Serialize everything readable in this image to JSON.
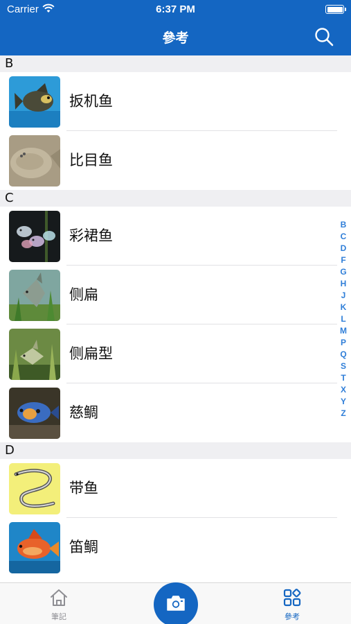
{
  "status_bar": {
    "carrier": "Carrier",
    "time": "6:37 PM"
  },
  "nav": {
    "title": "參考",
    "search_icon": "search-icon"
  },
  "colors": {
    "brand": "#1466c2",
    "index": "#2f7ed8",
    "section_bg": "#efeff2"
  },
  "sections": [
    {
      "letter": "B",
      "items": [
        {
          "name": "扳机鱼",
          "thumb": "triggerfish-photo"
        },
        {
          "name": "比目鱼",
          "thumb": "flounder-photo"
        }
      ]
    },
    {
      "letter": "C",
      "items": [
        {
          "name": "彩裙鱼",
          "thumb": "skirt-tetra-photo"
        },
        {
          "name": "侧扁",
          "thumb": "laterally-flat-fish-photo"
        },
        {
          "name": "侧扁型",
          "thumb": "laterally-flat-type-photo"
        },
        {
          "name": "慈鲷",
          "thumb": "cichlid-photo"
        }
      ]
    },
    {
      "letter": "D",
      "items": [
        {
          "name": "带鱼",
          "thumb": "hairtail-illustration"
        },
        {
          "name": "笛鲷",
          "thumb": "snapper-photo"
        }
      ]
    }
  ],
  "index_letters": [
    "B",
    "C",
    "D",
    "F",
    "G",
    "H",
    "J",
    "K",
    "L",
    "M",
    "P",
    "Q",
    "S",
    "T",
    "X",
    "Y",
    "Z"
  ],
  "tabbar": {
    "notes_label": "筆記",
    "reference_label": "參考",
    "notes_icon": "home-icon",
    "camera_icon": "camera-icon",
    "reference_icon": "grid-icon"
  }
}
